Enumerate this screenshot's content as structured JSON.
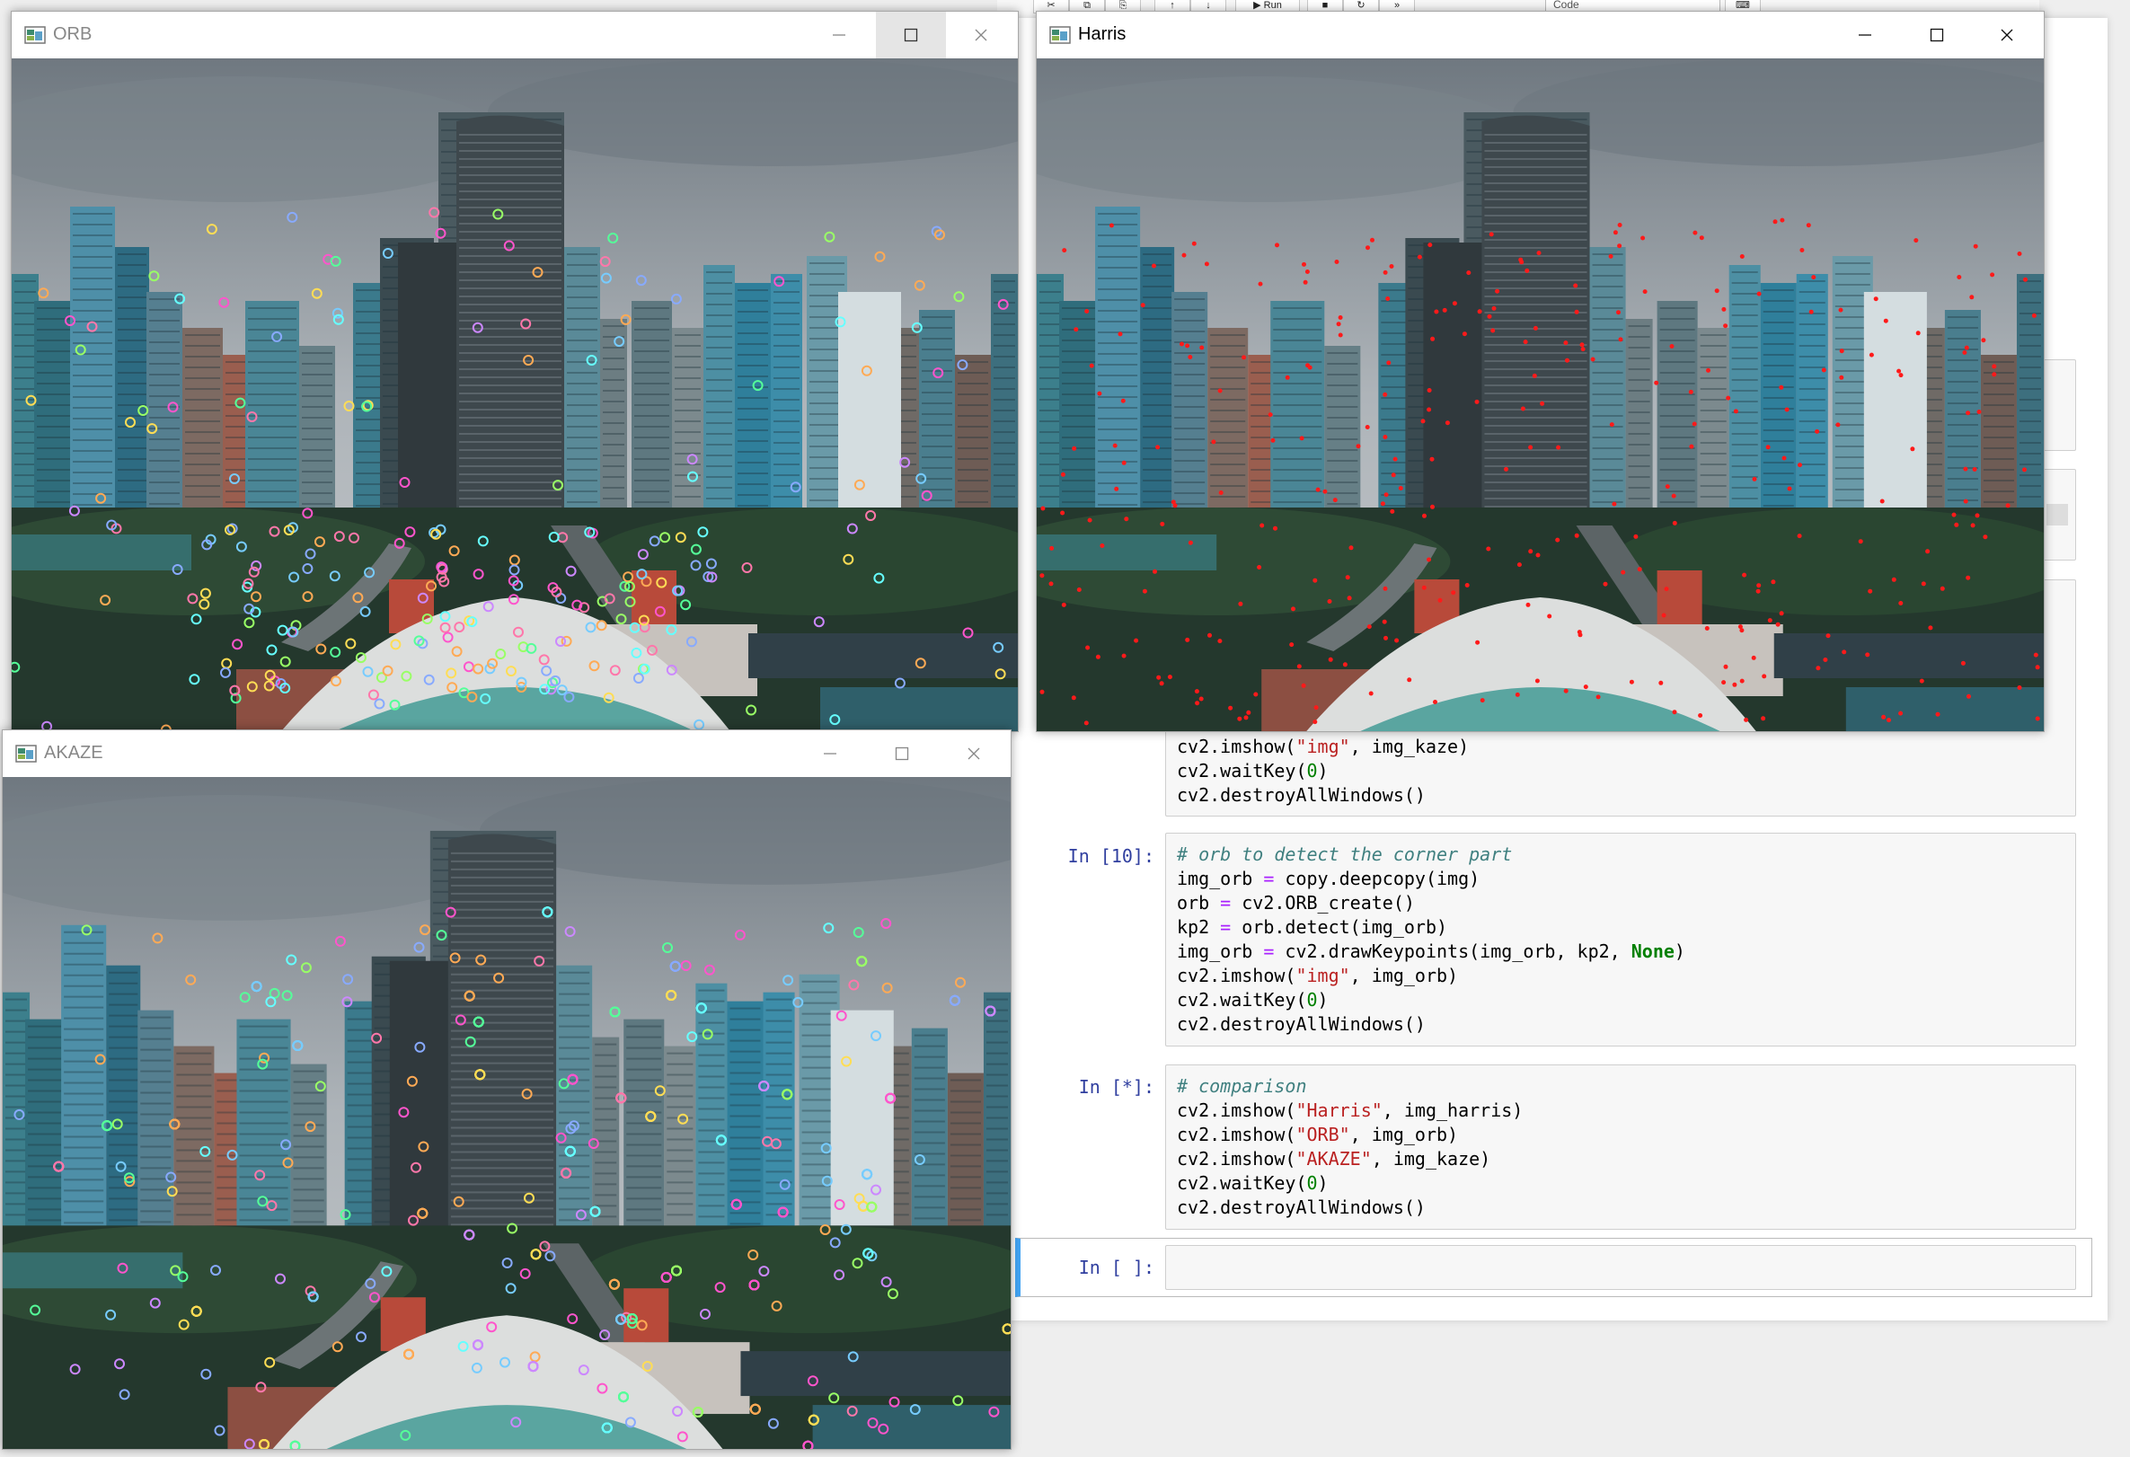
{
  "toolbar": {
    "run_label": "Run",
    "cell_type": "Code"
  },
  "windows": {
    "orb": {
      "title": "ORB",
      "icon": "opencv-window-icon",
      "keypoint_colors": "random-colored circles"
    },
    "harris": {
      "title": "Harris",
      "icon": "opencv-window-icon",
      "keypoint_colors": "red dots"
    },
    "akaze": {
      "title": "AKAZE",
      "icon": "opencv-window-icon",
      "keypoint_colors": "random-colored circles"
    }
  },
  "notebook": {
    "cell_kaze_tail": {
      "lines": [
        "cv2.imshow(\"img\", img_kaze)",
        "cv2.waitKey(0)",
        "cv2.destroyAllWindows()"
      ]
    },
    "cell_orb": {
      "prompt": "In [10]:",
      "lines": [
        "# orb to detect the corner part",
        "img_orb = copy.deepcopy(img)",
        "orb = cv2.ORB_create()",
        "kp2 = orb.detect(img_orb)",
        "img_orb = cv2.drawKeypoints(img_orb, kp2, None)",
        "cv2.imshow(\"img\", img_orb)",
        "cv2.waitKey(0)",
        "cv2.destroyAllWindows()"
      ]
    },
    "cell_compare": {
      "prompt": "In [*]:",
      "lines": [
        "# comparison",
        "cv2.imshow(\"Harris\", img_harris)",
        "cv2.imshow(\"ORB\", img_orb)",
        "cv2.imshow(\"AKAZE\", img_kaze)",
        "cv2.waitKey(0)",
        "cv2.destroyAllWindows()"
      ]
    },
    "cell_empty": {
      "prompt": "In [ ]:"
    }
  },
  "colors": {
    "prompt": "#303f9f",
    "comment": "#408080",
    "string": "#ba2121",
    "number": "#008000",
    "active_cell_bar": "#42a5f5",
    "harris_marker": "#ff1a1a"
  }
}
